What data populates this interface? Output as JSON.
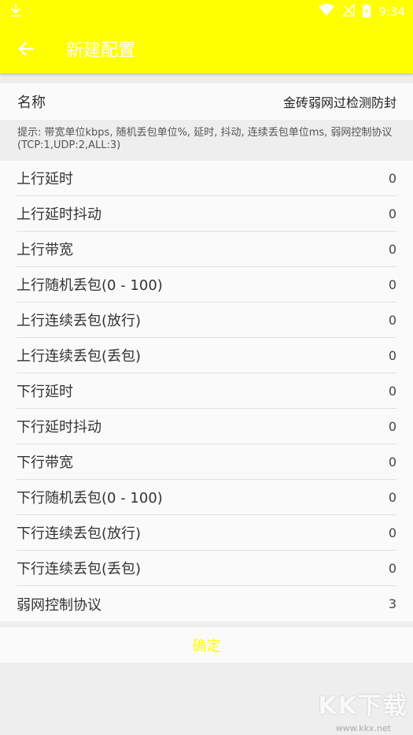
{
  "status_bar": {
    "time": "9:34",
    "download_icon": "download-icon",
    "wifi_icon": "wifi-icon",
    "signal_icon": "signal-icon",
    "battery_icon": "battery-charging-icon"
  },
  "app_bar": {
    "title": "新建配置",
    "back_icon": "arrow-back-icon"
  },
  "name_field": {
    "label": "名称",
    "value": "金砖弱网过检测防封"
  },
  "hint": "提示: 带宽单位kbps, 随机丢包单位%, 延时, 抖动, 连续丢包单位ms, 弱网控制协议(TCP:1,UDP:2,ALL:3)",
  "settings": [
    {
      "label": "上行延时",
      "value": "0"
    },
    {
      "label": "上行延时抖动",
      "value": "0"
    },
    {
      "label": "上行带宽",
      "value": "0"
    },
    {
      "label": "上行随机丢包(0 - 100)",
      "value": "0"
    },
    {
      "label": "上行连续丢包(放行)",
      "value": "0"
    },
    {
      "label": "上行连续丢包(丢包)",
      "value": "0"
    },
    {
      "label": "下行延时",
      "value": "0"
    },
    {
      "label": "下行延时抖动",
      "value": "0"
    },
    {
      "label": "下行带宽",
      "value": "0"
    },
    {
      "label": "下行随机丢包(0 - 100)",
      "value": "0"
    },
    {
      "label": "下行连续丢包(放行)",
      "value": "0"
    },
    {
      "label": "下行连续丢包(丢包)",
      "value": "0"
    },
    {
      "label": "弱网控制协议",
      "value": "3"
    }
  ],
  "confirm_label": "确定",
  "watermark": {
    "text": "KK下载",
    "url": "www.kkx.net"
  },
  "colors": {
    "accent": "#ffff00",
    "background": "#eeeeee",
    "row": "#fafafa"
  }
}
